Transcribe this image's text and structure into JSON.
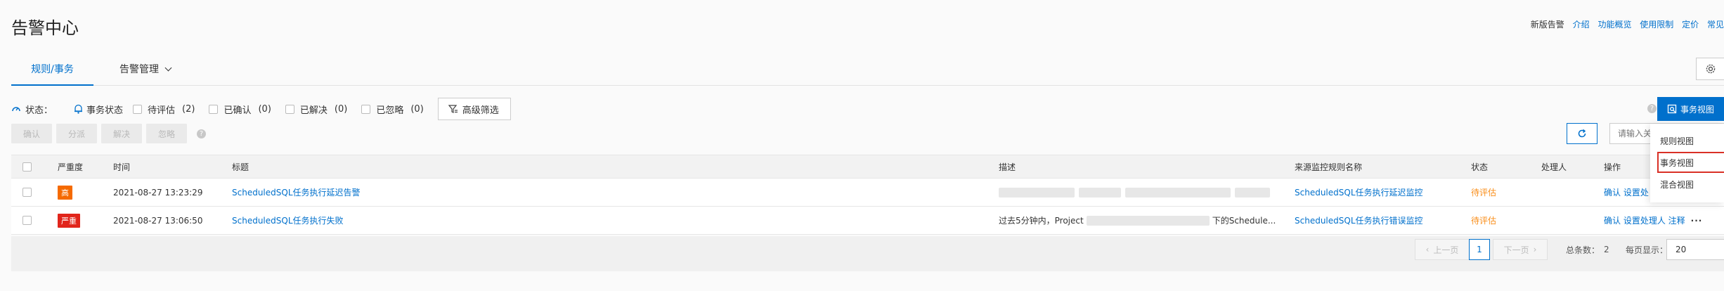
{
  "header": {
    "title": "告警中心",
    "links": [
      "新版告警",
      "介绍",
      "功能概览",
      "使用限制",
      "定价",
      "常见"
    ]
  },
  "tabs": [
    {
      "label": "规则/事务",
      "active": true
    },
    {
      "label": "告警管理",
      "active": false
    }
  ],
  "filters": {
    "status_label": "状态：",
    "event_status": "事务状态",
    "options": [
      {
        "label": "待评估",
        "count": "(2)"
      },
      {
        "label": "已确认",
        "count": "(0)"
      },
      {
        "label": "已解决",
        "count": "(0)"
      },
      {
        "label": "已忽略",
        "count": "(0)"
      }
    ],
    "advanced": "高级筛选"
  },
  "actions": [
    "确认",
    "分派",
    "解决",
    "忽略"
  ],
  "search": {
    "placeholder": "请输入关"
  },
  "view_switch": {
    "button": "事务视图",
    "menu": [
      "规则视图",
      "事务视图",
      "混合视图"
    ],
    "highlighted": "事务视图"
  },
  "table": {
    "columns": [
      "严重度",
      "时间",
      "标题",
      "描述",
      "来源监控规则名称",
      "状态",
      "处理人",
      "操作"
    ],
    "rows": [
      {
        "severity": "高",
        "time": "2021-08-27 13:23:29",
        "title": "ScheduledSQL任务执行延迟告警",
        "desc_start": "",
        "desc_end": "",
        "source": "ScheduledSQL任务执行延迟监控",
        "status": "待评估",
        "ops": "确认 设置处"
      },
      {
        "severity": "严重",
        "time": "2021-08-27 13:06:50",
        "title": "ScheduledSQL任务执行失败",
        "desc_start": "过去5分钟内，Project",
        "desc_end": "下的Schedule...",
        "source": "ScheduledSQL任务执行错误监控",
        "status": "待评估",
        "ops": "确认 设置处理人 注释"
      }
    ]
  },
  "pagination": {
    "prev": "上一页",
    "page": "1",
    "next": "下一页",
    "total_label": "总条数：",
    "total": "2",
    "size_label": "每页显示：",
    "size": "20"
  },
  "colors": {
    "primary": "#0070cc",
    "sev_high": "#f56a00",
    "sev_critical": "#e1251b",
    "pending": "#f98e1a",
    "highlight_box": "#d93026"
  }
}
